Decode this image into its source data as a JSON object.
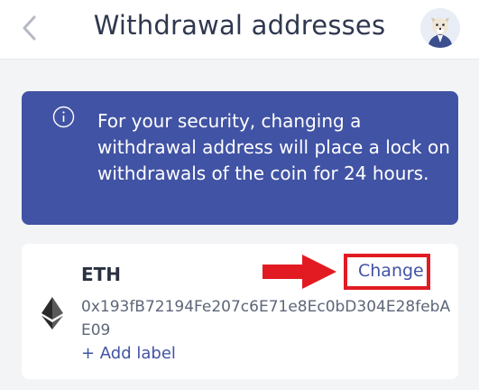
{
  "header": {
    "title": "Withdrawal addresses",
    "back_icon": "chevron-left-icon",
    "avatar_icon": "avatar-icon"
  },
  "banner": {
    "icon": "info-icon",
    "text": "For your security, changing a withdrawal address will place a lock on withdrawals of the coin for 24 hours.",
    "background": "#4153a4"
  },
  "address_card": {
    "coin": "ETH",
    "coin_icon": "ethereum-icon",
    "address": "0x193fB72194Fe207c6E71e8Ec0bD304E28febAE09",
    "add_label": "+ Add label",
    "change_label": "Change"
  },
  "annotation": {
    "arrow_icon": "arrow-right-icon",
    "highlight_color": "#e21b23"
  }
}
